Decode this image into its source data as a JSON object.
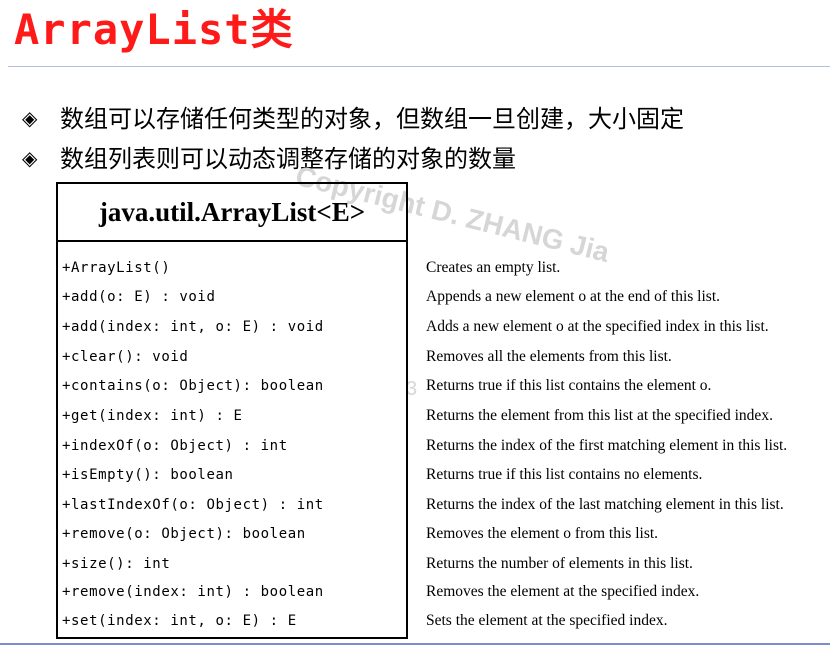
{
  "slide": {
    "title": "ArrayList类",
    "bullet_mark": "◈",
    "bullets": [
      "数组可以存储任何类型的对象，但数组一旦创建，大小固定",
      "数组列表则可以动态调整存储的对象的数量"
    ],
    "watermark": "Copyright D. ZHANG Jia",
    "watermark_digit": "3"
  },
  "uml": {
    "class_name": "java.util.ArrayList<E>",
    "methods": [
      {
        "signature": "+ArrayList()",
        "description": "Creates an empty list."
      },
      {
        "signature": "+add(o: E) : void",
        "description": "Appends a new element o at the end of this list."
      },
      {
        "signature": "+add(index: int, o: E) : void",
        "description": "Adds a new element o at the specified index in this list."
      },
      {
        "signature": "+clear(): void",
        "description": "Removes all the elements from this list."
      },
      {
        "signature": "+contains(o: Object): boolean",
        "description": "Returns true if this list contains the element o."
      },
      {
        "signature": "+get(index: int) : E",
        "description": "Returns the element from this list at the specified index."
      },
      {
        "signature": "+indexOf(o: Object) : int",
        "description": "Returns the index of the first matching element in this list."
      },
      {
        "signature": "+isEmpty(): boolean",
        "description": "Returns true if this list contains no elements."
      },
      {
        "signature": "+lastIndexOf(o: Object) : int",
        "description": "Returns the index of the last matching element in this list."
      },
      {
        "signature": "+remove(o: Object): boolean",
        "description": "Removes the element o from this list."
      },
      {
        "signature": "+size(): int",
        "description": "Returns the number of elements in this list."
      },
      {
        "signature": "+remove(index: int) : boolean",
        "description": "Removes the element at the specified index."
      },
      {
        "signature": "+set(index: int, o: E) : E",
        "description": "Sets the element at the specified index."
      }
    ]
  },
  "colors": {
    "title": "#ff1a1a",
    "rule": "#7f8ccf",
    "watermark": "#d6d6d6"
  }
}
